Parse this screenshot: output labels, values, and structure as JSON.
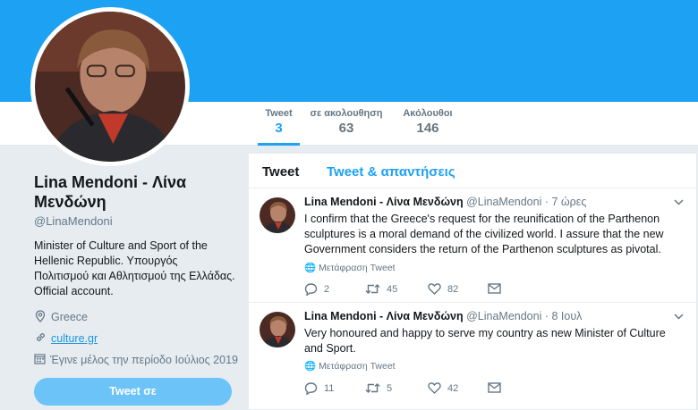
{
  "profile": {
    "name": "Lina Mendoni - Λίνα Μενδώνη",
    "handle": "@LinaMendoni",
    "bio": "Minister of Culture and Sport of the Hellenic Republic. Υπουργός Πολιτισμού και Αθλητισμού της Ελλάδας. Official account.",
    "location": "Greece",
    "website": "culture.gr",
    "joined": "Έγινε μέλος την περίοδο Ιούλιος 2019",
    "tweet_to_label": "Tweet σε"
  },
  "stats": [
    {
      "label": "Tweet",
      "value": "3"
    },
    {
      "label": "σε ακολουθηση",
      "value": "63"
    },
    {
      "label": "Ακόλουθοι",
      "value": "146"
    }
  ],
  "tabs": [
    "Tweet",
    "Tweet & απαντήσεις"
  ],
  "tweets": [
    {
      "name": "Lina Mendoni - Λίνα Μενδώνη",
      "handle": "@LinaMendoni",
      "time": "· 7 ώρες",
      "text": "I confirm that the Greece's request for the reunification of the Parthenon sculptures is a moral demand of the civilized world. I assure that the new Government considers the return of the Parthenon sculptures as pivotal.",
      "translate": "Μετάφραση Tweet",
      "replies": "2",
      "retweets": "45",
      "likes": "82"
    },
    {
      "name": "Lina Mendoni - Λίνα Μενδώνη",
      "handle": "@LinaMendoni",
      "time": "· 8 Ιουλ",
      "text": "Very honoured and happy to serve my country as new Minister of Culture and Sport.",
      "translate": "Μετάφραση Tweet",
      "replies": "11",
      "retweets": "5",
      "likes": "42"
    }
  ],
  "colors": {
    "accent": "#1da1f2",
    "link": "#1b95e0",
    "muted": "#657786",
    "background": "#e6ecf0"
  }
}
